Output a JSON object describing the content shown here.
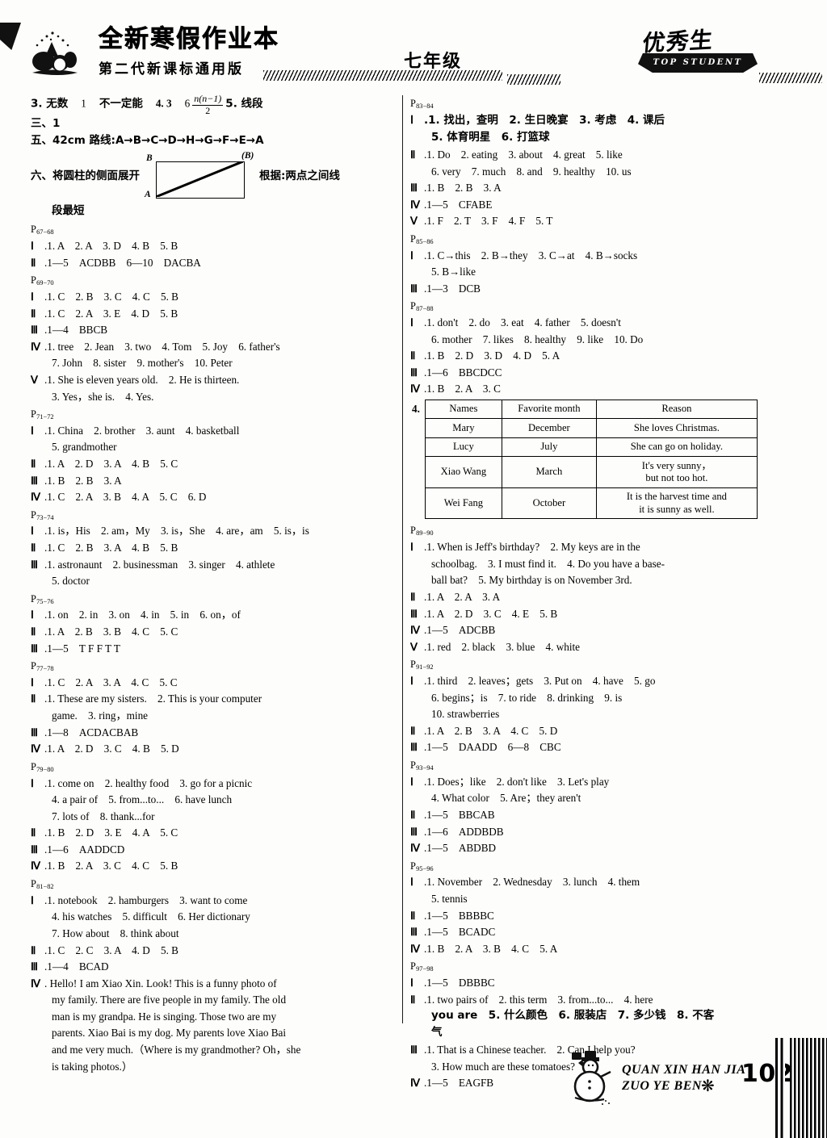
{
  "header": {
    "main_title": "全新寒假作业本",
    "sub_title": "第二代新课标通用版",
    "grade": "七年级",
    "logo_cn": "优秀生",
    "logo_en": "TOP STUDENT"
  },
  "footer": {
    "line1": "QUAN XIN HAN JIA",
    "line2": "ZUO YE BEN",
    "snowflake": "❋",
    "page_number": "102"
  },
  "left_column": {
    "math_line_3": {
      "prefix": "3. 无数",
      "v1": "1",
      "v2": "不一定能",
      "item4": "4. 3",
      "v3": "6",
      "frac_top": "n(n−1)",
      "frac_bot": "2",
      "item5": "5. 线段"
    },
    "math_line_three": "三、1",
    "math_line_five": "五、42cm  路线:A→B→C→D→H→G→F→E→A",
    "math_line_six_a": "六、将圆柱的侧面展开",
    "math_line_six_b": "根据:两点之间线",
    "math_line_six_c": "段最短",
    "geo_labels": {
      "top_left": "B",
      "top_right": "(B)",
      "bottom_left": "A"
    },
    "sections": [
      {
        "page": "P",
        "page_sub": "67−68",
        "lines": [
          {
            "rn": "Ⅰ",
            "text": ".1. A　2. A　3. D　4. B　5. B"
          },
          {
            "rn": "Ⅱ",
            "text": ".1—5　ACDBB　6—10　DACBA"
          }
        ]
      },
      {
        "page": "P",
        "page_sub": "69−70",
        "lines": [
          {
            "rn": "Ⅰ",
            "text": ".1. C　2. B　3. C　4. C　5. B"
          },
          {
            "rn": "Ⅱ",
            "text": ".1. C　2. A　3. E　4. D　5. B"
          },
          {
            "rn": "Ⅲ",
            "text": ".1—4　BBCB"
          },
          {
            "rn": "Ⅳ",
            "text": ".1. tree　2. Jean　3. two　4. Tom　5. Joy　6. father's"
          },
          {
            "rn": "",
            "indent": true,
            "text": "7. John　8. sister　9. mother's　10. Peter"
          },
          {
            "rn": "Ⅴ",
            "text": ".1. She is eleven years old.　2. He is thirteen."
          },
          {
            "rn": "",
            "indent": true,
            "text": "3. Yes，she is.　4. Yes."
          }
        ]
      },
      {
        "page": "P",
        "page_sub": "71−72",
        "lines": [
          {
            "rn": "Ⅰ",
            "text": ".1. China　2. brother　3. aunt　4. basketball"
          },
          {
            "rn": "",
            "indent": true,
            "text": "5. grandmother"
          },
          {
            "rn": "Ⅱ",
            "text": ".1. A　2. D　3. A　4. B　5. C"
          },
          {
            "rn": "Ⅲ",
            "text": ".1. B　2. B　3. A"
          },
          {
            "rn": "Ⅳ",
            "text": ".1. C　2. A　3. B　4. A　5. C　6. D"
          }
        ]
      },
      {
        "page": "P",
        "page_sub": "73−74",
        "lines": [
          {
            "rn": "Ⅰ",
            "text": ".1. is，His　2. am，My　3. is，She　4. are，am　5. is，is"
          },
          {
            "rn": "Ⅱ",
            "text": ".1. C　2. B　3. A　4. B　5. B"
          },
          {
            "rn": "Ⅲ",
            "text": ".1. astronaunt　2. businessman　3. singer　4. athlete"
          },
          {
            "rn": "",
            "indent": true,
            "text": "5. doctor"
          }
        ]
      },
      {
        "page": "P",
        "page_sub": "75−76",
        "lines": [
          {
            "rn": "Ⅰ",
            "text": ".1. on　2. in　3. on　4. in　5. in　6. on，of"
          },
          {
            "rn": "Ⅱ",
            "text": ".1. A　2. B　3. B　4. C　5. C"
          },
          {
            "rn": "Ⅲ",
            "text": ".1—5　T F F T T"
          }
        ]
      },
      {
        "page": "P",
        "page_sub": "77−78",
        "lines": [
          {
            "rn": "Ⅰ",
            "text": ".1. C　2. A　3. A　4. C　5. C"
          },
          {
            "rn": "Ⅱ",
            "justify": true,
            "text": ".1. These are my sisters.　2. This is your computer"
          },
          {
            "rn": "",
            "indent": true,
            "text": "game.　3. ring，mine"
          },
          {
            "rn": "Ⅲ",
            "text": ".1—8　ACDACBAB"
          },
          {
            "rn": "Ⅳ",
            "text": ".1. A　2. D　3. C　4. B　5. D"
          }
        ]
      },
      {
        "page": "P",
        "page_sub": "79−80",
        "lines": [
          {
            "rn": "Ⅰ",
            "text": ".1. come on　2. healthy food　3. go for a picnic"
          },
          {
            "rn": "",
            "indent": true,
            "text": "4. a pair of　5. from...to...　6. have lunch"
          },
          {
            "rn": "",
            "indent": true,
            "text": "7. lots of　8. thank...for"
          },
          {
            "rn": "Ⅱ",
            "text": ".1. B　2. D　3. E　4. A　5. C"
          },
          {
            "rn": "Ⅲ",
            "text": ".1—6　AADDCD"
          },
          {
            "rn": "Ⅳ",
            "text": ".1. B　2. A　3. C　4. C　5. B"
          }
        ]
      },
      {
        "page": "P",
        "page_sub": "81−82",
        "lines": [
          {
            "rn": "Ⅰ",
            "text": ".1. notebook　2. hamburgers　3. want to come"
          },
          {
            "rn": "",
            "indent": true,
            "text": "4. his watches　5. difficult　6. Her dictionary"
          },
          {
            "rn": "",
            "indent": true,
            "text": "7. How about　8. think about"
          },
          {
            "rn": "Ⅱ",
            "text": ".1. C　2. C　3. A　4. D　5. B"
          },
          {
            "rn": "Ⅲ",
            "text": ".1—4　BCAD"
          },
          {
            "rn": "Ⅳ",
            "justify": true,
            "text": ". Hello! I am Xiao Xin. Look! This is a funny photo of"
          },
          {
            "rn": "",
            "indent": true,
            "justify": true,
            "text": "my family. There are five people in my family. The old"
          },
          {
            "rn": "",
            "indent": true,
            "justify": true,
            "text": "man is my grandpa. He is singing. Those two are my"
          },
          {
            "rn": "",
            "indent": true,
            "justify": true,
            "text": "parents. Xiao Bai is my dog. My parents love Xiao Bai"
          },
          {
            "rn": "",
            "indent": true,
            "justify": true,
            "text": "and me very much.（Where is my grandmother? Oh，she"
          },
          {
            "rn": "",
            "indent": true,
            "text": "is taking photos.）"
          }
        ]
      }
    ]
  },
  "right_column": {
    "sections_top": [
      {
        "page": "P",
        "page_sub": "83−84",
        "lines": [
          {
            "rn": "Ⅰ",
            "cn": true,
            "text": ".1. 找出，查明　2. 生日晚宴　3. 考虑　4. 课后"
          },
          {
            "rn": "",
            "indent": true,
            "cn": true,
            "text": "5. 体育明星　6. 打篮球"
          },
          {
            "rn": "Ⅱ",
            "text": ".1. Do　2. eating　3. about　4. great　5. like"
          },
          {
            "rn": "",
            "indent": true,
            "text": "6. very　7. much　8. and　9. healthy　10. us"
          },
          {
            "rn": "Ⅲ",
            "text": ".1. B　2. B　3. A"
          },
          {
            "rn": "Ⅳ",
            "text": ".1—5　CFABE"
          },
          {
            "rn": "Ⅴ",
            "text": ".1. F　2. T　3. F　4. F　5. T"
          }
        ]
      },
      {
        "page": "P",
        "page_sub": "85−86",
        "lines": [
          {
            "rn": "Ⅰ",
            "text": ".1. C→this　2. B→they　3. C→at　4. B→socks"
          },
          {
            "rn": "",
            "indent": true,
            "text": "5. B→like"
          },
          {
            "rn": "Ⅲ",
            "text": ".1—3　DCB"
          }
        ]
      },
      {
        "page": "P",
        "page_sub": "87−88",
        "lines": [
          {
            "rn": "Ⅰ",
            "text": ".1. don't　2. do　3. eat　4. father　5. doesn't"
          },
          {
            "rn": "",
            "indent": true,
            "text": "6. mother　7. likes　8. healthy　9. like　10. Do"
          },
          {
            "rn": "Ⅱ",
            "text": ".1. B　2. D　3. D　4. D　5. A"
          },
          {
            "rn": "Ⅲ",
            "text": ".1—6　BBCDCC"
          },
          {
            "rn": "Ⅳ",
            "text": ".1. B　2. A　3. C"
          }
        ]
      }
    ],
    "table": {
      "item_number": "4.",
      "headers": [
        "Names",
        "Favorite month",
        "Reason"
      ],
      "rows": [
        [
          "Mary",
          "December",
          "She loves Christmas."
        ],
        [
          "Lucy",
          "July",
          "She can go on holiday."
        ],
        [
          "Xiao Wang",
          "March",
          "It's very sunny，\nbut not too hot."
        ],
        [
          "Wei Fang",
          "October",
          "It is the harvest time and\nit is sunny as well."
        ]
      ]
    },
    "sections_bottom": [
      {
        "page": "P",
        "page_sub": "89−90",
        "lines": [
          {
            "rn": "Ⅰ",
            "justify": true,
            "text": ".1. When is Jeff's birthday?　2. My keys are in the"
          },
          {
            "rn": "",
            "indent": true,
            "justify": true,
            "text": "schoolbag.　3. I must find it.　4. Do you have a base-"
          },
          {
            "rn": "",
            "indent": true,
            "text": "ball bat?　5. My birthday is on November 3rd."
          },
          {
            "rn": "Ⅱ",
            "text": ".1. A　2. A　3. A"
          },
          {
            "rn": "Ⅲ",
            "text": ".1. A　2. D　3. C　4. E　5. B"
          },
          {
            "rn": "Ⅳ",
            "text": ".1—5　ADCBB"
          },
          {
            "rn": "Ⅴ",
            "text": ".1. red　2. black　3. blue　4. white"
          }
        ]
      },
      {
        "page": "P",
        "page_sub": "91−92",
        "lines": [
          {
            "rn": "Ⅰ",
            "text": ".1. third　2. leaves；gets　3. Put on　4. have　5. go"
          },
          {
            "rn": "",
            "indent": true,
            "text": "6. begins；is　7. to ride　8. drinking　9. is"
          },
          {
            "rn": "",
            "indent": true,
            "text": "10. strawberries"
          },
          {
            "rn": "Ⅱ",
            "text": ".1. A　2. B　3. A　4. C　5. D"
          },
          {
            "rn": "Ⅲ",
            "text": ".1—5　DAADD　6—8　CBC"
          }
        ]
      },
      {
        "page": "P",
        "page_sub": "93−94",
        "lines": [
          {
            "rn": "Ⅰ",
            "text": ".1. Does；like　2. don't like　3. Let's play"
          },
          {
            "rn": "",
            "indent": true,
            "text": "4. What color　5. Are；they aren't"
          },
          {
            "rn": "Ⅱ",
            "text": ".1—5　BBCAB"
          },
          {
            "rn": "Ⅲ",
            "text": ".1—6　ADDBDB"
          },
          {
            "rn": "Ⅳ",
            "text": ".1—5　ABDBD"
          }
        ]
      },
      {
        "page": "P",
        "page_sub": "95−96",
        "lines": [
          {
            "rn": "Ⅰ",
            "text": ".1. November　2. Wednesday　3. lunch　4. them"
          },
          {
            "rn": "",
            "indent": true,
            "text": "5. tennis"
          },
          {
            "rn": "Ⅱ",
            "text": ".1—5　BBBBC"
          },
          {
            "rn": "Ⅲ",
            "text": ".1—5　BCADC"
          },
          {
            "rn": "Ⅳ",
            "text": ".1. B　2. A　3. B　4. C　5. A"
          }
        ]
      },
      {
        "page": "P",
        "page_sub": "97−98",
        "lines": [
          {
            "rn": "Ⅰ",
            "text": ".1—5　DBBBC"
          },
          {
            "rn": "Ⅱ",
            "justify": true,
            "text": ".1. two pairs of　2. this term　3. from...to...　4. here"
          },
          {
            "rn": "",
            "indent": true,
            "cn": true,
            "text": "you are　5. 什么颜色　6. 服装店　7. 多少钱　8. 不客"
          },
          {
            "rn": "",
            "indent": true,
            "cn": true,
            "text": "气"
          },
          {
            "rn": "Ⅲ",
            "text": ".1. That is a Chinese teacher.　2. Can I help you?"
          },
          {
            "rn": "",
            "indent": true,
            "text": "3. How much are these tomatoes?"
          },
          {
            "rn": "Ⅳ",
            "text": ".1—5　EAGFB"
          }
        ]
      }
    ]
  }
}
